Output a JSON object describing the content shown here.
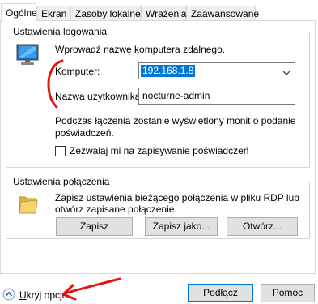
{
  "tabs": [
    {
      "label": "Ogólne",
      "active": true
    },
    {
      "label": "Ekran"
    },
    {
      "label": "Zasoby lokalne"
    },
    {
      "label": "Wrażenia"
    },
    {
      "label": "Zaawansowane"
    }
  ],
  "logon": {
    "group_title": "Ustawienia logowania",
    "intro": "Wprowadź nazwę komputera zdalnego.",
    "computer_label": "Komputer:",
    "computer_value": "192.168.1.8",
    "username_label": "Nazwa użytkownika:",
    "username_value": "nocturne-admin",
    "info_line1": "Podczas łączenia zostanie wyświetlony monit o podanie",
    "info_line2": "poświadczeń.",
    "save_credentials_label": "Zezwalaj mi na zapisywanie poświadczeń",
    "save_credentials_checked": false
  },
  "connection": {
    "group_title": "Ustawienia połączenia",
    "desc_line1": "Zapisz ustawienia bieżącego połączenia w pliku RDP lub",
    "desc_line2": "otwórz zapisane połączenie.",
    "save_label": "Zapisz",
    "save_as_label": "Zapisz jako...",
    "open_label": "Otwórz..."
  },
  "footer": {
    "hide_options_prefix": "U",
    "hide_options_rest": "kryj opcje",
    "connect_label": "Podłącz",
    "help_label": "Pomoc"
  },
  "colors": {
    "accent": "#0078d7",
    "annotation": "#e8120c"
  }
}
